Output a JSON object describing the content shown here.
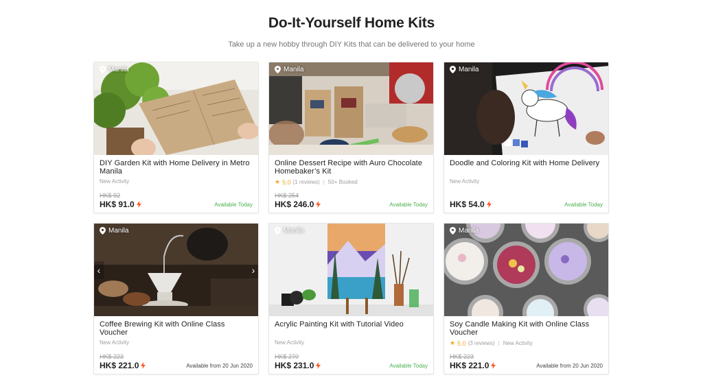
{
  "header": {
    "title": "Do-It-Yourself Home Kits",
    "subtitle": "Take up a new hobby through DIY Kits that can be delivered to your home"
  },
  "cards": [
    {
      "location": "Manila",
      "title": "DIY Garden Kit with Home Delivery in Metro Manila",
      "meta_tag": "New Activity",
      "old_price": "HK$ 92",
      "price": "HK$ 91.0",
      "availability": "Available Today"
    },
    {
      "location": "Manila",
      "title": "Online Dessert Recipe with Auro Chocolate Homebaker’s Kit",
      "rating": "5.0",
      "reviews": "(1 reviews)",
      "booked": "50+ Booked",
      "old_price": "HK$ 254",
      "price": "HK$ 246.0",
      "availability": "Available Today"
    },
    {
      "location": "Manila",
      "title": "Doodle and Coloring Kit with Home Delivery",
      "meta_tag": "New Activity",
      "price": "HK$ 54.0",
      "availability": "Available Today"
    },
    {
      "location": "Manila",
      "title": "Coffee Brewing Kit with Online Class Voucher",
      "meta_tag": "New Activity",
      "old_price": "HK$ 223",
      "price": "HK$ 221.0",
      "availability": "Available from 20 Jun 2020",
      "carousel_prev": "‹",
      "carousel_next": "›"
    },
    {
      "location": "Manila",
      "title": "Acrylic Painting Kit with Tutorial Video",
      "meta_tag": "New Activity",
      "old_price": "HK$ 270",
      "price": "HK$ 231.0",
      "availability": "Available Today"
    },
    {
      "location": "Manila",
      "title": "Soy Candle Making Kit with Online Class Voucher",
      "rating": "5.0",
      "reviews": "(3 reviews)",
      "meta_tag": "New Activity",
      "old_price": "HK$ 223",
      "price": "HK$ 221.0",
      "availability": "Available from 20 Jun 2020"
    }
  ],
  "icons": {
    "location": "map-pin-icon",
    "instant": "lightning-bolt-icon",
    "rating": "star-icon"
  },
  "colors": {
    "available_today": "#4caf50",
    "instant_bolt": "#ff5722",
    "star": "#f5a623"
  }
}
